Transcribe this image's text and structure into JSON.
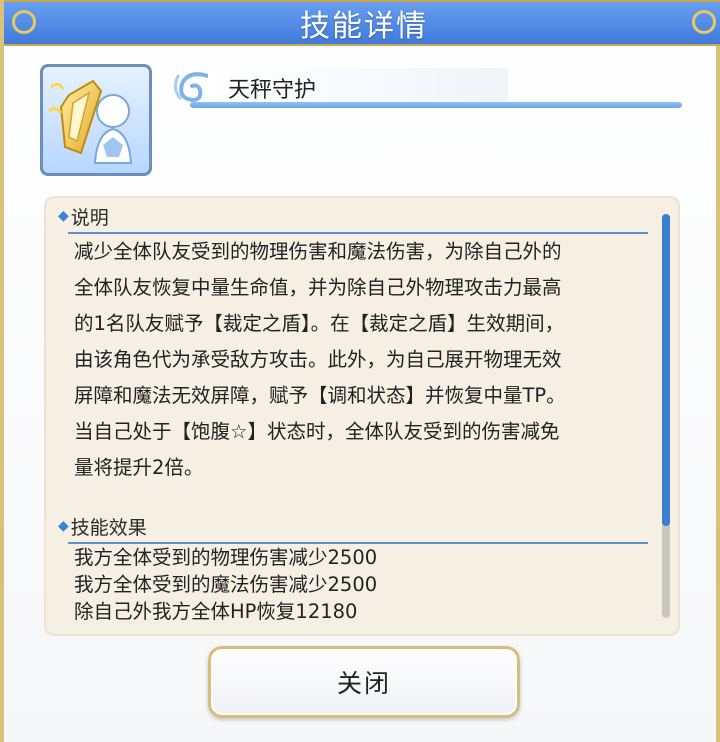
{
  "header": {
    "title": "技能详情"
  },
  "skill": {
    "name": "天秤守护",
    "icon": "golden-shield-portrait-icon"
  },
  "description_section": {
    "heading": "说明",
    "lines": [
      "减少全体队友受到的物理伤害和魔法伤害，为除自己外的",
      "全体队友恢复中量生命值，并为除自己外物理攻击力最高",
      "的1名队友赋予【裁定之盾】。在【裁定之盾】生效期间，",
      "由该角色代为承受敌方攻击。此外，为自己展开物理无效",
      "屏障和魔法无效屏障，赋予【调和状态】并恢复中量TP。",
      "当自己处于【饱腹☆】状态时，全体队友受到的伤害减免",
      "量将提升2倍。"
    ]
  },
  "effects_section": {
    "heading": "技能效果",
    "lines": [
      "我方全体受到的物理伤害减少2500",
      "我方全体受到的魔法伤害减少2500",
      "除自己外我方全体HP恢复12180"
    ]
  },
  "scroll": {
    "position_fraction": 0.0
  },
  "buttons": {
    "close_label": "关闭"
  },
  "colors": {
    "header_blue": "#4f86e3",
    "accent_gold": "#d9c27a",
    "panel_bg": "#f6efe3",
    "section_blue": "#3b84d6"
  }
}
